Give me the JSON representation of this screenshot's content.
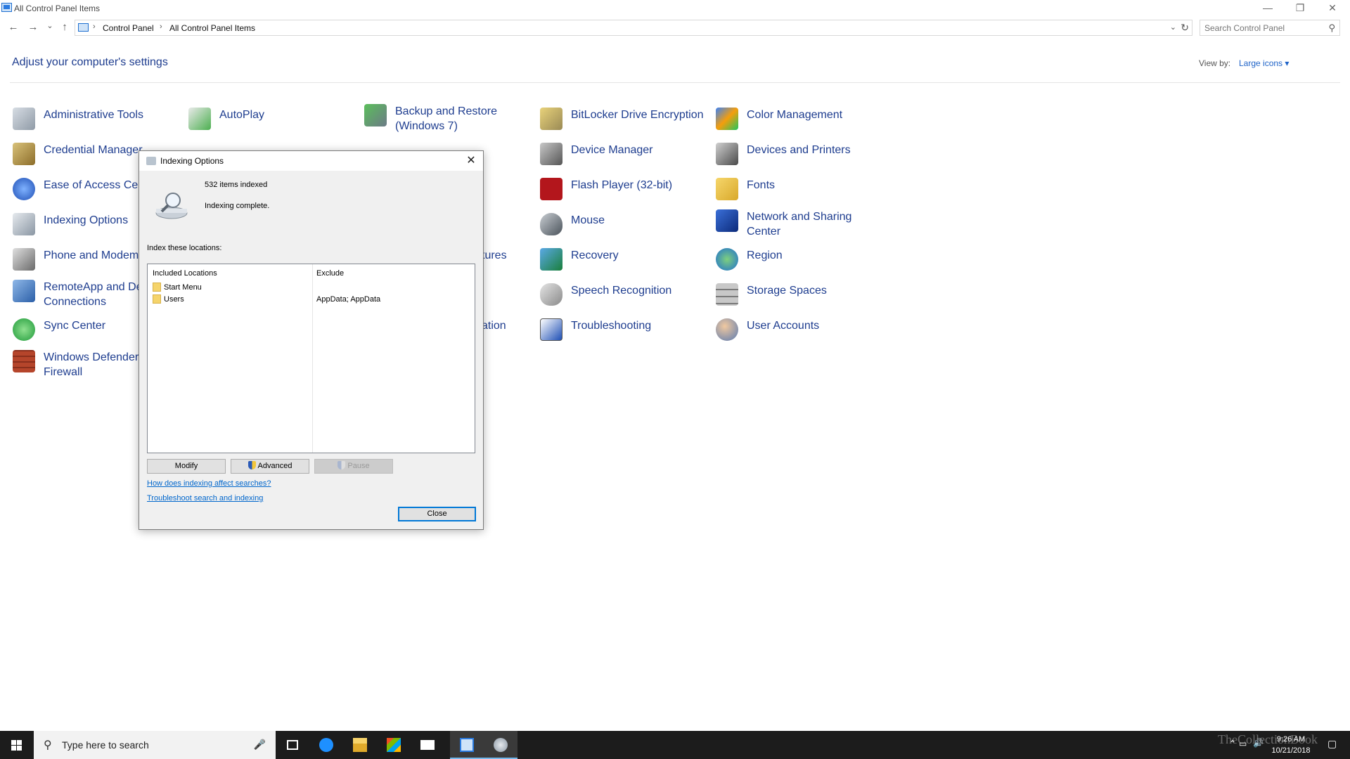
{
  "window": {
    "title": "All Control Panel Items",
    "minimize_glyph": "—",
    "restore_glyph": "❐",
    "close_glyph": "✕"
  },
  "nav": {
    "back_glyph": "←",
    "forward_glyph": "→",
    "recent_glyph": "⌄",
    "up_glyph": "↑"
  },
  "address": {
    "sep": "›",
    "crumbs": [
      "Control Panel",
      "All Control Panel Items"
    ],
    "dropdown_glyph": "⌄",
    "refresh_glyph": "↻"
  },
  "search": {
    "placeholder": "Search Control Panel",
    "icon_glyph": "⚲"
  },
  "header": {
    "title": "Adjust your computer's settings",
    "view_by_label": "View by:",
    "view_by_value": "Large icons ▾"
  },
  "items": [
    {
      "label": "Administrative Tools",
      "icon": "admin-tools-icon"
    },
    {
      "label": "AutoPlay",
      "icon": "autoplay-icon"
    },
    {
      "label": "Backup and Restore\n(Windows 7)",
      "icon": "backup-icon"
    },
    {
      "label": "BitLocker Drive Encryption",
      "icon": "bitlocker-icon"
    },
    {
      "label": "Color Management",
      "icon": "color-management-icon"
    },
    {
      "label": "Credential Manager",
      "icon": "credential-manager-icon"
    },
    {
      "label": "Device Manager",
      "icon": "device-manager-icon"
    },
    {
      "label": "Devices and Printers",
      "icon": "printer-icon"
    },
    {
      "label": "Ease of Access Center",
      "icon": "ease-of-access-icon"
    },
    {
      "label": "Flash Player (32-bit)",
      "icon": "flash-icon"
    },
    {
      "label": "Fonts",
      "icon": "fonts-icon"
    },
    {
      "label": "Indexing Options",
      "icon": "indexing-icon"
    },
    {
      "label": "Mouse",
      "icon": "mouse-icon"
    },
    {
      "label": "Network and Sharing\nCenter",
      "icon": "network-icon"
    },
    {
      "label": "Phone and Modem",
      "icon": "phone-modem-icon"
    },
    {
      "label": "tures",
      "icon": ""
    },
    {
      "label": "Recovery",
      "icon": "recovery-icon"
    },
    {
      "label": "Region",
      "icon": "region-icon"
    },
    {
      "label": "RemoteApp and Desktop\nConnections",
      "icon": "remoteapp-icon"
    },
    {
      "label": "Speech Recognition",
      "icon": "microphone-icon"
    },
    {
      "label": "Storage Spaces",
      "icon": "storage-icon"
    },
    {
      "label": "Sync Center",
      "icon": "sync-icon"
    },
    {
      "label": "ation",
      "icon": ""
    },
    {
      "label": "Troubleshooting",
      "icon": "troubleshooting-icon"
    },
    {
      "label": "User Accounts",
      "icon": "user-accounts-icon"
    },
    {
      "label": "Windows Defender\nFirewall",
      "icon": "firewall-icon"
    }
  ],
  "dialog": {
    "title": "Indexing Options",
    "close_glyph": "✕",
    "items_indexed": "532 items indexed",
    "status": "Indexing complete.",
    "locations_label": "Index these locations:",
    "columns": [
      "Included Locations",
      "Exclude"
    ],
    "rows": [
      {
        "location": "Start Menu",
        "exclude": ""
      },
      {
        "location": "Users",
        "exclude": "AppData; AppData"
      }
    ],
    "buttons": {
      "modify": "Modify",
      "advanced": "Advanced",
      "pause": "Pause",
      "close": "Close"
    },
    "links": [
      "How does indexing affect searches?",
      "Troubleshoot search and indexing"
    ]
  },
  "taskbar": {
    "search_glyph": "⚲",
    "mic_glyph": "🎤",
    "search_text": "Type here to search",
    "apps": [
      "task-view-icon",
      "edge-icon",
      "file-explorer-icon",
      "store-icon",
      "mail-icon",
      "control-panel-icon",
      "indexing-options-icon"
    ],
    "tray_glyphs": [
      "⌃",
      "▭",
      "🔊"
    ],
    "notification_glyph": "▢",
    "time": "9:26 AM",
    "date": "10/21/2018",
    "watermark": "TheCollectionBook"
  },
  "colors": {
    "link": "#1e3d8f",
    "accent": "#0078d7",
    "taskbar": "#1c1c1c"
  }
}
